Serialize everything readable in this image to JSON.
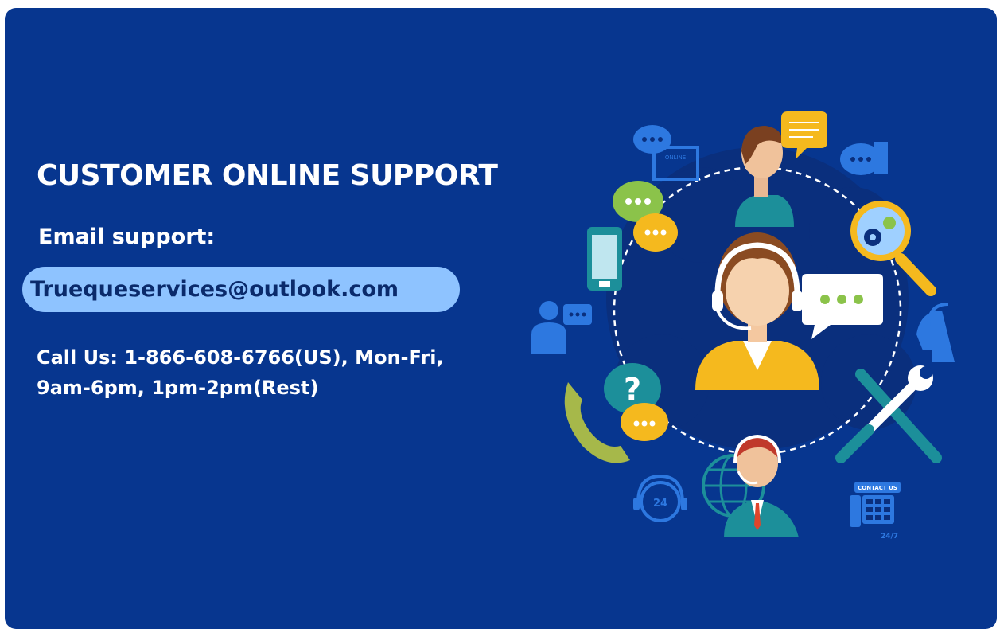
{
  "heading": "CUSTOMER ONLINE SUPPORT",
  "email": {
    "label": "Email support:",
    "address": "Truequeservices@outlook.com"
  },
  "call": {
    "line1": "Call Us: 1-866-608-6766(US), Mon-Fri,",
    "line2": "9am-6pm, 1pm-2pm(Rest)"
  },
  "illustration": {
    "badge_24": "24",
    "contact_us": "CONTACT US",
    "badge_247": "24/7",
    "online_label": "ONLINE"
  },
  "colors": {
    "background": "#07368f",
    "pill": "#8ec3ff",
    "accent_yellow": "#f5b91e",
    "accent_teal": "#1c8f9a",
    "icon_blue": "#2d78e0"
  },
  "icons": [
    "chat-bubble-icon",
    "smartphone-icon",
    "magnifier-gear-icon",
    "question-icon",
    "phone-receiver-icon",
    "headset-24-icon",
    "wrench-screwdriver-icon",
    "globe-icon",
    "contact-phone-icon",
    "headset-head-icon"
  ]
}
